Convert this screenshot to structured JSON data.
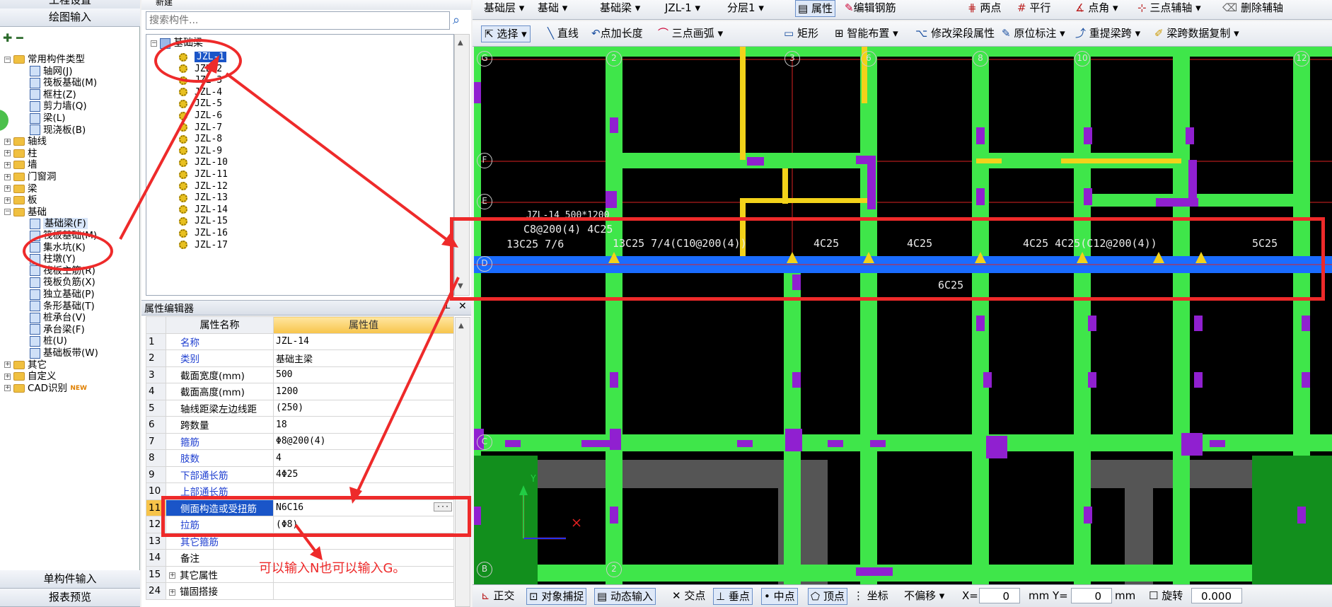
{
  "left_panel": {
    "top_buttons": [
      "工程设置",
      "绘图输入"
    ],
    "bottom_buttons": [
      "单构件输入",
      "报表预览"
    ],
    "tree": [
      {
        "label": "常用构件类型",
        "level": 0,
        "expanded": true
      },
      {
        "label": "轴网(J)",
        "level": 1
      },
      {
        "label": "筏板基础(M)",
        "level": 1
      },
      {
        "label": "框柱(Z)",
        "level": 1
      },
      {
        "label": "剪力墙(Q)",
        "level": 1
      },
      {
        "label": "梁(L)",
        "level": 1
      },
      {
        "label": "现浇板(B)",
        "level": 1
      },
      {
        "label": "轴线",
        "level": 0
      },
      {
        "label": "柱",
        "level": 0
      },
      {
        "label": "墙",
        "level": 0
      },
      {
        "label": "门窗洞",
        "level": 0
      },
      {
        "label": "梁",
        "level": 0
      },
      {
        "label": "板",
        "level": 0
      },
      {
        "label": "基础",
        "level": 0,
        "expanded": true
      },
      {
        "label": "基础梁(F)",
        "level": 1,
        "selected": true
      },
      {
        "label": "筏板基础(M)",
        "level": 1
      },
      {
        "label": "集水坑(K)",
        "level": 1
      },
      {
        "label": "柱墩(Y)",
        "level": 1
      },
      {
        "label": "筏板主筋(R)",
        "level": 1
      },
      {
        "label": "筏板负筋(X)",
        "level": 1
      },
      {
        "label": "独立基础(P)",
        "level": 1
      },
      {
        "label": "条形基础(T)",
        "level": 1
      },
      {
        "label": "桩承台(V)",
        "level": 1
      },
      {
        "label": "承台梁(F)",
        "level": 1
      },
      {
        "label": "桩(U)",
        "level": 1
      },
      {
        "label": "基础板带(W)",
        "level": 1
      },
      {
        "label": "其它",
        "level": 0
      },
      {
        "label": "自定义",
        "level": 0
      },
      {
        "label": "CAD识别",
        "level": 0
      }
    ],
    "new_badge": "NEW"
  },
  "component_list": {
    "toolbar_new": "新建",
    "search_placeholder": "搜索构件...",
    "root": "基础梁",
    "items": [
      "JZL-1",
      "JZL-2",
      "JZL-3",
      "JZL-4",
      "JZL-5",
      "JZL-6",
      "JZL-7",
      "JZL-8",
      "JZL-9",
      "JZL-10",
      "JZL-11",
      "JZL-12",
      "JZL-13",
      "JZL-14",
      "JZL-15",
      "JZL-16",
      "JZL-17"
    ]
  },
  "property_editor": {
    "title": "属性编辑器",
    "col_name": "属性名称",
    "col_value": "属性值",
    "rows": [
      {
        "no": "1",
        "name": "名称",
        "value": "JZL-14",
        "blue": true
      },
      {
        "no": "2",
        "name": "类别",
        "value": "基础主梁",
        "blue": true
      },
      {
        "no": "3",
        "name": "截面宽度(mm)",
        "value": "500",
        "blue": false
      },
      {
        "no": "4",
        "name": "截面高度(mm)",
        "value": "1200",
        "blue": false
      },
      {
        "no": "5",
        "name": "轴线距梁左边线距",
        "value": "(250)",
        "blue": false
      },
      {
        "no": "6",
        "name": "跨数量",
        "value": "18",
        "blue": false
      },
      {
        "no": "7",
        "name": "箍筋",
        "value": "Φ8@200(4)",
        "blue": true
      },
      {
        "no": "8",
        "name": "肢数",
        "value": "4",
        "blue": true
      },
      {
        "no": "9",
        "name": "下部通长筋",
        "value": "4Φ25",
        "blue": true
      },
      {
        "no": "10",
        "name": "上部通长筋",
        "value": "",
        "blue": true
      },
      {
        "no": "11",
        "name": "侧面构造或受扭筋",
        "value": "N6C16",
        "blue": true,
        "selected": true
      },
      {
        "no": "12",
        "name": "拉筋",
        "value": "(Φ8)",
        "blue": true
      },
      {
        "no": "13",
        "name": "其它箍筋",
        "value": "",
        "blue": true
      },
      {
        "no": "14",
        "name": "备注",
        "value": "",
        "blue": false
      },
      {
        "no": "15",
        "name": "其它属性",
        "value": "",
        "blue": false,
        "group": true
      },
      {
        "no": "24",
        "name": "锚固搭接",
        "value": "",
        "blue": false,
        "group": true
      }
    ],
    "ellipsis": "···"
  },
  "annotation_note": "可以输入N也可以输入G。",
  "topbar": {
    "floor": "基础层",
    "type": "基础",
    "subtype": "基础梁",
    "component": "JZL-1",
    "layer": "分层1",
    "properties": "属性",
    "edit_rebar": "编辑钢筋",
    "two_point": "两点",
    "parallel": "平行",
    "point_angle": "点角",
    "three_point_aux": "三点辅轴",
    "delete_aux": "删除辅轴"
  },
  "toolbar2": {
    "select": "选择",
    "line": "直线",
    "point_length": "点加长度",
    "three_point_arc": "三点画弧",
    "rect": "矩形",
    "smart_layout": "智能布置",
    "modify_span": "修改梁段属性",
    "in_situ": "原位标注",
    "re_span": "重提梁跨",
    "copy_span": "梁跨数据复制"
  },
  "canvas": {
    "axis_rows": [
      "G",
      "F",
      "E",
      "D",
      "C",
      "B"
    ],
    "axis_cols": [
      "2",
      "3",
      "6",
      "8",
      "10",
      "12"
    ],
    "labels": {
      "beam_head1": "JZL-14 500*1200",
      "beam_head2": "C8@200(4) 4C25",
      "left_rebar": "13C25 7/6",
      "span1": "13C25 7/4(C10@200(4))",
      "span2": "4C25",
      "span3": "4C25",
      "span4": "4C25 4C25(C12@200(4))",
      "span5": "5C25",
      "bottom": "6C25"
    },
    "ucs_x": "X",
    "ucs_y": "Y"
  },
  "status": {
    "ortho": "正交",
    "snap": "对象捕捉",
    "dyn_input": "动态输入",
    "intersection": "交点",
    "perp": "垂点",
    "midpoint": "中点",
    "vertex": "顶点",
    "coord": "坐标",
    "offset": "不偏移",
    "x_label": "X=",
    "x_value": "0",
    "y_label": "mm Y=",
    "y_value": "0",
    "mm": "mm",
    "rotate": "旋转",
    "rotate_value": "0.000"
  },
  "colors": {
    "beam_green": "#3fe64a",
    "beam_blue": "#1a6cff",
    "accent_red": "#ee2a2a",
    "yellow": "#f2d21a"
  }
}
